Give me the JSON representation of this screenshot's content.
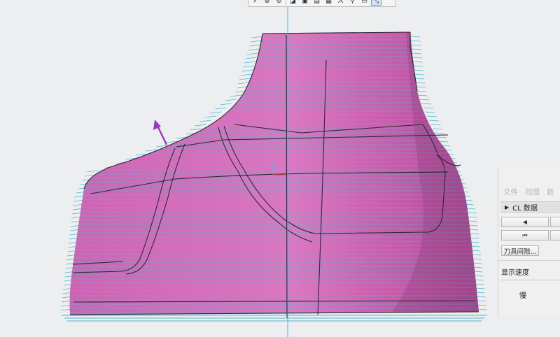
{
  "toolbar": {
    "icons": [
      "zoom-fit-icon",
      "zoom-in-icon",
      "zoom-out-icon",
      "shading-icon",
      "view-orient-icon",
      "display-style-icon",
      "layers-icon",
      "axes-icon",
      "datum-icon",
      "annotation-icon",
      "toolpath-display-icon"
    ],
    "active_icon": "toolpath-display-icon"
  },
  "model": {
    "surface_color": "#d970bd",
    "toolpath_color": "#4fb6d2",
    "edge_color": "#2a2a33",
    "direction_arrow_color": "#9a36c8"
  },
  "panel": {
    "menu": [
      "文件",
      "视图",
      "数"
    ],
    "section_title": "CL 数据",
    "step_back_label": "◀",
    "rewind_label": "⏮",
    "tool_gap_button": "刀具间隙...",
    "display_speed_label": "显示速度",
    "slow_label": "慢"
  }
}
